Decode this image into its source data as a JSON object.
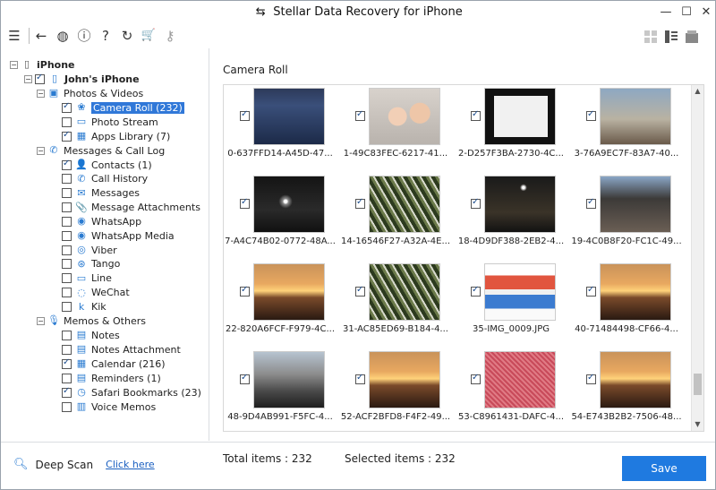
{
  "window": {
    "title": "Stellar Data Recovery for iPhone",
    "title_icon": "⇆",
    "minimize": "—",
    "maximize": "☐",
    "close": "✕"
  },
  "toolbar": {
    "menu_icon": "☰",
    "back_icon": "←",
    "globe_icon": "◍",
    "info_icon": "ⓘ",
    "help_icon": "?",
    "refresh_icon": "↻",
    "cart_icon": "🛒",
    "key_icon": "⚷"
  },
  "tree": {
    "root": "iPhone",
    "device": "John's iPhone",
    "photos_group": "Photos & Videos",
    "photos": [
      {
        "label": "Camera Roll (232)",
        "checked": true
      },
      {
        "label": "Photo Stream",
        "checked": false
      },
      {
        "label": "Apps Library (7)",
        "checked": true
      }
    ],
    "messages_group": "Messages & Call Log",
    "messages": [
      {
        "label": "Contacts (1)",
        "checked": true,
        "icon": "👤"
      },
      {
        "label": "Call History",
        "checked": false,
        "icon": "✆"
      },
      {
        "label": "Messages",
        "checked": false,
        "icon": "✉"
      },
      {
        "label": "Message Attachments",
        "checked": false,
        "icon": "📎"
      },
      {
        "label": "WhatsApp",
        "checked": false,
        "icon": "◉"
      },
      {
        "label": "WhatsApp Media",
        "checked": false,
        "icon": "◉"
      },
      {
        "label": "Viber",
        "checked": false,
        "icon": "◎"
      },
      {
        "label": "Tango",
        "checked": false,
        "icon": "⊛"
      },
      {
        "label": "Line",
        "checked": false,
        "icon": "▭"
      },
      {
        "label": "WeChat",
        "checked": false,
        "icon": "◌"
      },
      {
        "label": "Kik",
        "checked": false,
        "icon": "k"
      }
    ],
    "memos_group": "Memos & Others",
    "memos": [
      {
        "label": "Notes",
        "checked": false,
        "icon": "▤"
      },
      {
        "label": "Notes Attachment",
        "checked": false,
        "icon": "▤"
      },
      {
        "label": "Calendar (216)",
        "checked": true,
        "icon": "▦"
      },
      {
        "label": "Reminders (1)",
        "checked": false,
        "icon": "▤"
      },
      {
        "label": "Safari Bookmarks (23)",
        "checked": true,
        "icon": "◷"
      },
      {
        "label": "Voice Memos",
        "checked": false,
        "icon": "▥"
      }
    ]
  },
  "main": {
    "title": "Camera Roll",
    "items": [
      {
        "caption": "0-637FFD14-A45D-47...",
        "thumb": "t-screen"
      },
      {
        "caption": "1-49C83FEC-6217-41...",
        "thumb": "t-kids"
      },
      {
        "caption": "2-D257F3BA-2730-4C...",
        "thumb": "t-doc"
      },
      {
        "caption": "3-76A9EC7F-83A7-40...",
        "thumb": "t-tower"
      },
      {
        "caption": "7-A4C74B02-0772-48A...",
        "thumb": "t-night"
      },
      {
        "caption": "14-16546F27-A32A-4E...",
        "thumb": "t-tree"
      },
      {
        "caption": "18-4D9DF388-2EB2-4...",
        "thumb": "t-night2"
      },
      {
        "caption": "19-4C0B8F20-FC1C-49...",
        "thumb": "t-rest"
      },
      {
        "caption": "22-820A6FCF-F979-4C...",
        "thumb": "t-sunset"
      },
      {
        "caption": "31-AC85ED69-B184-4...",
        "thumb": "t-tree"
      },
      {
        "caption": "35-IMG_0009.JPG",
        "thumb": "t-chart"
      },
      {
        "caption": "40-71484498-CF66-4...",
        "thumb": "t-sunset"
      },
      {
        "caption": "48-9D4AB991-F5FC-4...",
        "thumb": "t-balcony"
      },
      {
        "caption": "52-ACF2BFD8-F4F2-49...",
        "thumb": "t-sunset"
      },
      {
        "caption": "53-C8961431-DAFC-4...",
        "thumb": "t-pink"
      },
      {
        "caption": "54-E743B2B2-7506-48...",
        "thumb": "t-sunset"
      }
    ]
  },
  "footer": {
    "deep_scan": "Deep Scan",
    "click_here": "Click here",
    "total": "Total items : 232",
    "selected": "Selected items : 232",
    "save": "Save"
  }
}
